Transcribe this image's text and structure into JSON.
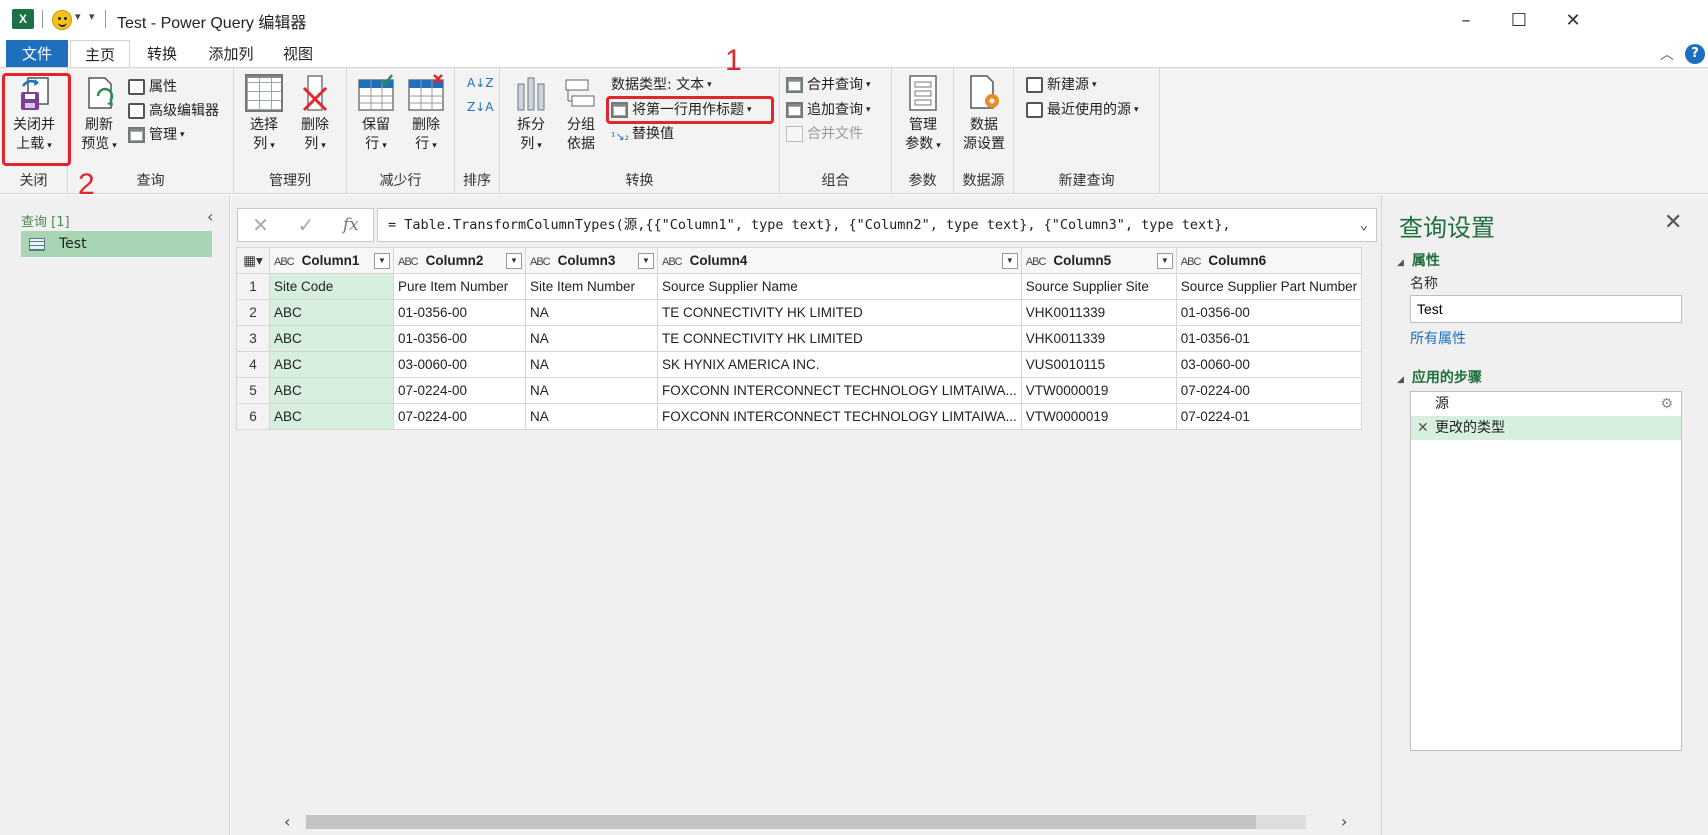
{
  "window": {
    "title": "Test - Power Query 编辑器",
    "app_badge": "X"
  },
  "tabs": {
    "file": "文件",
    "home": "主页",
    "transform": "转换",
    "add_column": "添加列",
    "view": "视图"
  },
  "ribbon": {
    "close": {
      "close_load_line1": "关闭并",
      "close_load_line2": "上载",
      "label": "关闭"
    },
    "query": {
      "refresh_line1": "刷新",
      "refresh_line2": "预览",
      "properties": "属性",
      "advanced_editor": "高级编辑器",
      "manage": "管理",
      "label": "查询"
    },
    "manage_columns": {
      "choose_line1": "选择",
      "choose_line2": "列",
      "remove_line1": "删除",
      "remove_line2": "列",
      "label": "管理列"
    },
    "reduce_rows": {
      "keep_line1": "保留",
      "keep_line2": "行",
      "remove_line1": "删除",
      "remove_line2": "行",
      "label": "减少行"
    },
    "sort": {
      "label": "排序"
    },
    "transform": {
      "split_line1": "拆分",
      "split_line2": "列",
      "group_line1": "分组",
      "group_line2": "依据",
      "data_type": "数据类型: 文本",
      "use_first_row": "将第一行用作标题",
      "replace_values": "替换值",
      "label": "转换"
    },
    "combine": {
      "merge_queries": "合并查询",
      "append_queries": "追加查询",
      "combine_files": "合并文件",
      "label": "组合"
    },
    "parameters": {
      "manage_line1": "管理",
      "manage_line2": "参数",
      "label": "参数"
    },
    "data_source": {
      "settings_line1": "数据",
      "settings_line2": "源设置",
      "label": "数据源"
    },
    "new_query": {
      "new_source": "新建源",
      "recent_sources": "最近使用的源",
      "label": "新建查询"
    }
  },
  "annotations": {
    "one": "1",
    "two": "2"
  },
  "queries_panel": {
    "header": "查询 [1]",
    "items": [
      "Test"
    ]
  },
  "formula_bar": {
    "cancel": "✕",
    "commit": "✓",
    "fx": "fx",
    "formula": "= Table.TransformColumnTypes(源,{{\"Column1\", type text}, {\"Column2\", type text}, {\"Column3\", type text},"
  },
  "grid": {
    "type_badge": "ABC",
    "columns": [
      "Column1",
      "Column2",
      "Column3",
      "Column4",
      "Column5",
      "Column6"
    ],
    "rows": [
      [
        "1",
        "Site Code",
        "Pure Item Number",
        "Site Item Number",
        "Source Supplier Name",
        "Source Supplier Site",
        "Source Supplier Part Number"
      ],
      [
        "2",
        "ABC",
        "01-0356-00",
        "NA",
        "TE CONNECTIVITY HK LIMITED",
        "VHK0011339",
        "01-0356-00"
      ],
      [
        "3",
        "ABC",
        "01-0356-00",
        "NA",
        "TE CONNECTIVITY HK LIMITED",
        "VHK0011339",
        "01-0356-01"
      ],
      [
        "4",
        "ABC",
        "03-0060-00",
        "NA",
        "SK HYNIX AMERICA INC.",
        "VUS0010115",
        "03-0060-00"
      ],
      [
        "5",
        "ABC",
        "07-0224-00",
        "NA",
        "FOXCONN INTERCONNECT TECHNOLOGY LIMTAIWA...",
        "VTW0000019",
        "07-0224-00"
      ],
      [
        "6",
        "ABC",
        "07-0224-00",
        "NA",
        "FOXCONN INTERCONNECT TECHNOLOGY LIMTAIWA...",
        "VTW0000019",
        "07-0224-01"
      ]
    ]
  },
  "query_settings": {
    "title": "查询设置",
    "properties_header": "属性",
    "name_label": "名称",
    "name_value": "Test",
    "all_properties": "所有属性",
    "applied_steps_header": "应用的步骤",
    "steps": [
      "源",
      "更改的类型"
    ]
  },
  "colors": {
    "accent_blue": "#1f6fbf",
    "excel_green": "#1d7044",
    "selection_green": "#d7efdf",
    "annotation_red": "#e3262c"
  }
}
